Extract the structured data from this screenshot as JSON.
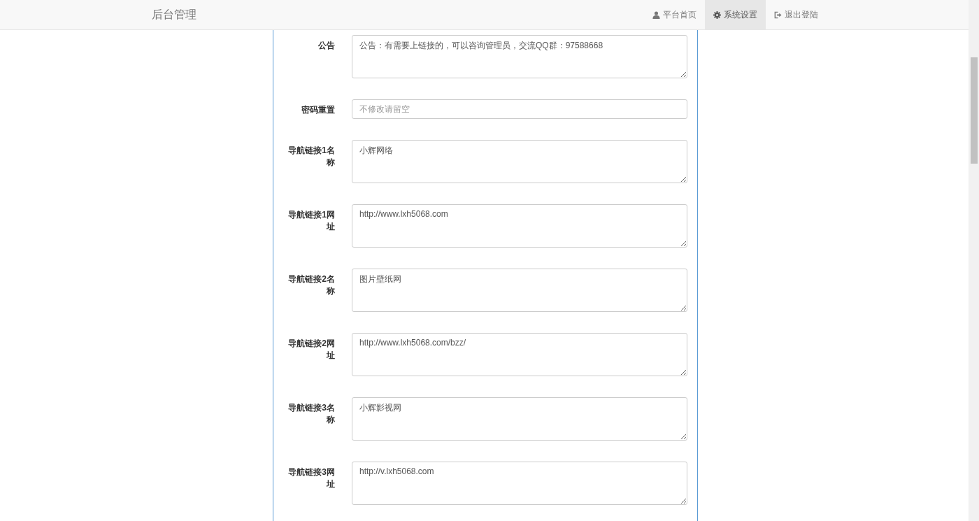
{
  "navbar": {
    "brand": "后台管理",
    "items": [
      {
        "label": "平台首页",
        "kind": "user",
        "selected": false
      },
      {
        "label": "系统设置",
        "kind": "gear",
        "selected": true
      },
      {
        "label": "退出登陆",
        "kind": "signout",
        "selected": false
      }
    ]
  },
  "form": [
    {
      "label": "公告",
      "kind": "textarea",
      "value": "公告：有需要上链接的，可以咨询管理员，交流QQ群：97588668"
    },
    {
      "label": "密码重置",
      "kind": "input",
      "placeholder": "不修改请留空"
    },
    {
      "label": "导航链接1名称",
      "kind": "textarea",
      "value": "小辉网络"
    },
    {
      "label": "导航链接1网址",
      "kind": "textarea",
      "value": "http://www.lxh5068.com"
    },
    {
      "label": "导航链接2名称",
      "kind": "textarea",
      "value": "图片壁纸网"
    },
    {
      "label": "导航链接2网址",
      "kind": "textarea",
      "value": "http://www.lxh5068.com/bzz/"
    },
    {
      "label": "导航链接3名称",
      "kind": "textarea",
      "value": "小辉影视网"
    },
    {
      "label": "导航链接3网址",
      "kind": "textarea",
      "value": "http://v.lxh5068.com"
    }
  ]
}
